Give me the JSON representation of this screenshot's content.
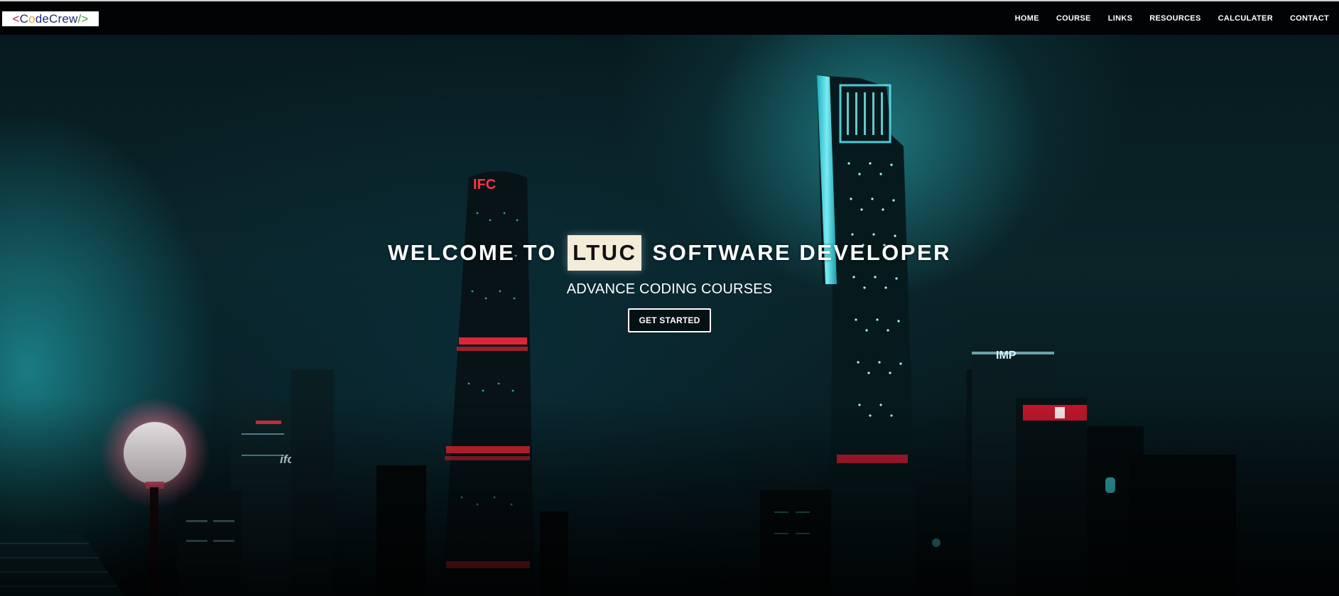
{
  "nav": {
    "logo": {
      "lt": "<",
      "c": "C",
      "o": "o",
      "mid": "deCrew",
      "gt": "/>"
    },
    "links": [
      "HOME",
      "COURSE",
      "LINKS",
      "RESOURCES",
      "CALCULATER",
      "CONTACT"
    ]
  },
  "hero": {
    "title_before": "WELCOME TO",
    "title_highlight": "LTUC",
    "title_after": "SOFTWARE DEVELOPER",
    "subtitle": "ADVANCE CODING COURSES",
    "button_label": "GET STARTED"
  },
  "scene": {
    "tower_left_sign": "IFC",
    "building_small_sign": "ifc",
    "building_right_sign": "IMP"
  },
  "colors": {
    "nav_bg": "#020304",
    "highlight_bg": "#f3ecd9",
    "neon_cyan": "#2fd6e0",
    "neon_red": "#ff2a3c"
  }
}
